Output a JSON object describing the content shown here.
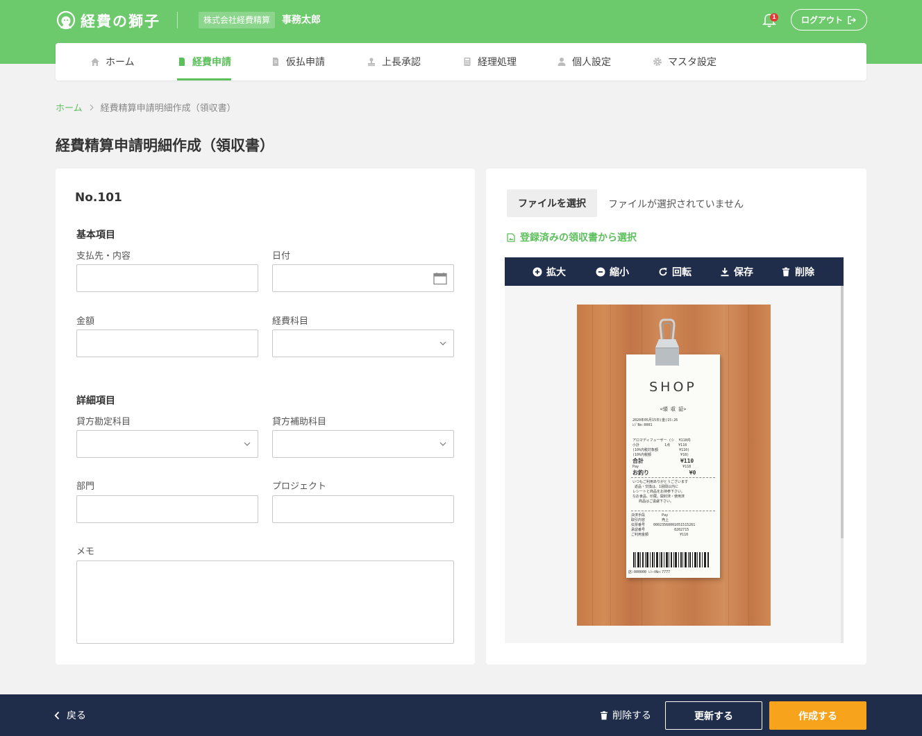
{
  "header": {
    "logo_text": "経費の獅子",
    "company": "株式会社経費精算",
    "user": "事務太郎",
    "notification_count": "1",
    "logout_label": "ログアウト"
  },
  "nav": {
    "items": [
      {
        "label": "ホーム",
        "icon": "home-icon"
      },
      {
        "label": "経費申請",
        "icon": "document-icon",
        "active": true
      },
      {
        "label": "仮払申請",
        "icon": "document-icon"
      },
      {
        "label": "上長承認",
        "icon": "stamp-icon"
      },
      {
        "label": "経理処理",
        "icon": "calculator-icon"
      },
      {
        "label": "個人設定",
        "icon": "user-icon"
      },
      {
        "label": "マスタ設定",
        "icon": "gear-icon"
      }
    ]
  },
  "breadcrumb": {
    "home": "ホーム",
    "current": "経費精算申請明細作成（領収書）"
  },
  "page_title": "経費精算申請明細作成（領収書）",
  "form": {
    "number": "No.101",
    "basic_section": "基本項目",
    "payee_label": "支払先・内容",
    "date_label": "日付",
    "amount_label": "金額",
    "expense_category_label": "経費科目",
    "detail_section": "詳細項目",
    "credit_account_label": "貸方勘定科目",
    "credit_sub_account_label": "貸方補助科目",
    "department_label": "部門",
    "project_label": "プロジェクト",
    "memo_label": "メモ"
  },
  "upload": {
    "choose_file": "ファイルを選択",
    "no_file": "ファイルが選択されていません",
    "registered_link": "登録済みの領収書から選択"
  },
  "viewer": {
    "zoom_in": "拡大",
    "zoom_out": "縮小",
    "rotate": "回転",
    "save": "保存",
    "delete": "削除"
  },
  "receipt": {
    "shop": "SHOP",
    "heading": "<領 収 証>",
    "datetime": "2020年05月15日(金)15:26",
    "register": "ﾚｼﾞNo:0001",
    "item_line": "アロマディフューザー (シ  ¥110内",
    "subtotal_line": "小計            1点    ¥110",
    "tax_target": "(10%内税対象額          ¥110)",
    "tax_amount": "(10%内税額              ¥10)",
    "total_line": "合計           ¥110",
    "pay_line": "Pay                     ¥110",
    "change_line": "お釣り            ¥0",
    "message_lines": "いつもご利用ありがとうございます\n 返品・交換は、1週間以内に\nレシートと商品をお持参下さい。\nなお食品、印蔵、開封済・使用済\n   商品はご遠慮下さい。",
    "payment_lines": "決済手段        Pay\n取引内容        売上\n伝票番号    00023560001051515261\n承認番号              0202715\nご利用金額               ¥110",
    "footer": "店:000000 ﾚｼｰﾄNo:7777"
  },
  "footer": {
    "back": "戻る",
    "delete": "削除する",
    "update": "更新する",
    "create": "作成する"
  }
}
